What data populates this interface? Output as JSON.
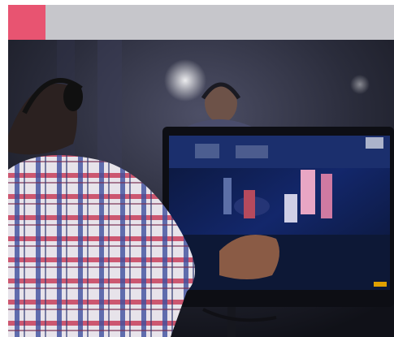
{
  "header": {
    "accent_color": "#e85471",
    "bar_color": "#c6c6cb"
  },
  "photo": {
    "subject": "person-with-headphones-watching-monitor",
    "monitor_icon": "monitor-icon"
  }
}
